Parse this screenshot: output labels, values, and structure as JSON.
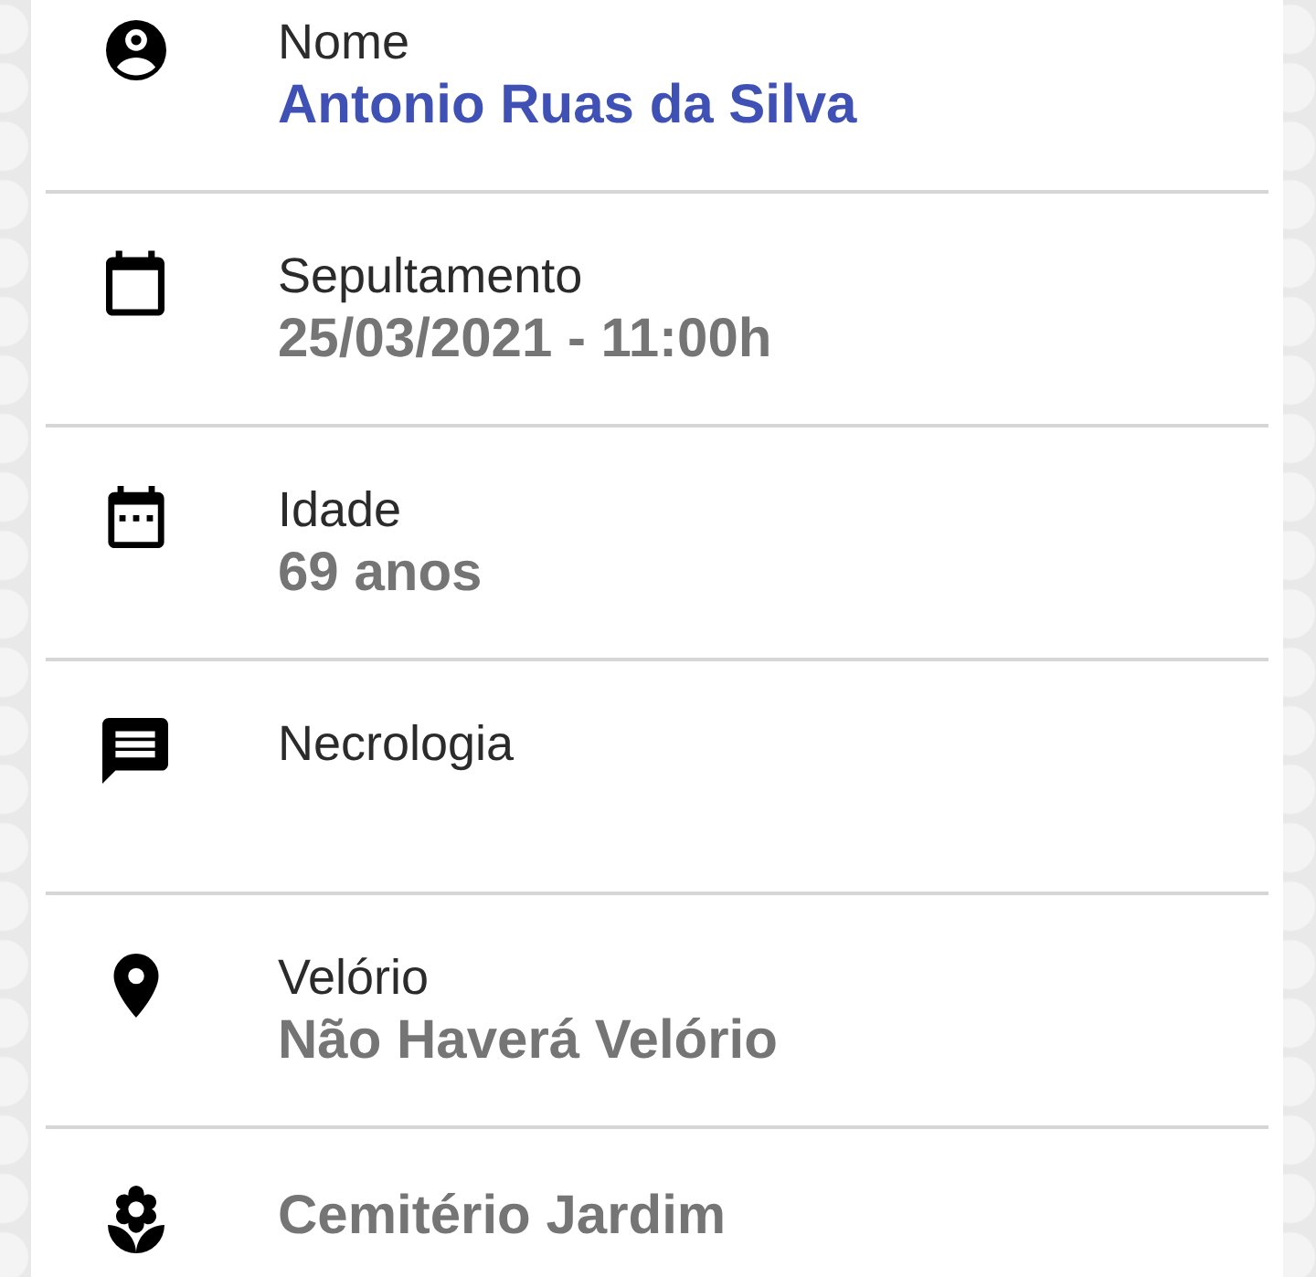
{
  "fields": [
    {
      "kind": "name",
      "label": "Nome",
      "value": "Antonio Ruas da Silva"
    },
    {
      "kind": "burial",
      "label": "Sepultamento",
      "value": "25/03/2021 - 11:00h"
    },
    {
      "kind": "age",
      "label": "Idade",
      "value": "69 anos"
    },
    {
      "kind": "obituary",
      "label": "Necrologia"
    },
    {
      "kind": "wake",
      "label": "Velório",
      "value": "Não Haverá Velório"
    },
    {
      "kind": "cemetery",
      "value": "Cemitério Jardim"
    }
  ]
}
